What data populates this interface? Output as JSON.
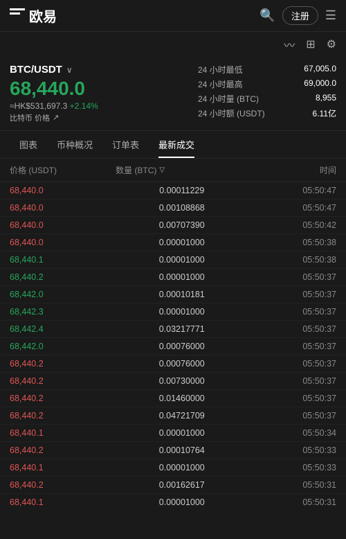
{
  "header": {
    "logo_text": "欧易",
    "register_label": "注册",
    "search_icon": "🔍",
    "menu_icon": "☰"
  },
  "header2": {
    "chart_icon": "📈",
    "grid_icon": "⊞",
    "settings_icon": "⚙"
  },
  "market": {
    "pair": "BTC/USDT",
    "arrow": "∨",
    "price": "68,440.0",
    "hkd_price": "≈HK$531,697.3",
    "change": "+2.14%",
    "label": "比特币 价格",
    "external_icon": "↗",
    "stats": [
      {
        "label": "24 小时最低",
        "value": "67,005.0"
      },
      {
        "label": "24 小时最高",
        "value": "69,000.0"
      },
      {
        "label": "24 小时量 (BTC)",
        "value": "8,955"
      },
      {
        "label": "24 小时额 (USDT)",
        "value": "6.11亿"
      }
    ]
  },
  "tabs": [
    {
      "id": "chart",
      "label": "图表"
    },
    {
      "id": "overview",
      "label": "币种概况"
    },
    {
      "id": "orders",
      "label": "订单表"
    },
    {
      "id": "trades",
      "label": "最新成交",
      "active": true
    }
  ],
  "table": {
    "col_price": "价格 (USDT)",
    "col_qty": "数量 (BTC)",
    "col_time": "时间",
    "rows": [
      {
        "price": "68,440.0",
        "color": "red",
        "qty": "0.00011229",
        "time": "05:50:47"
      },
      {
        "price": "68,440.0",
        "color": "red",
        "qty": "0.00108868",
        "time": "05:50:47"
      },
      {
        "price": "68,440.0",
        "color": "red",
        "qty": "0.00707390",
        "time": "05:50:42"
      },
      {
        "price": "68,440.0",
        "color": "red",
        "qty": "0.00001000",
        "time": "05:50:38"
      },
      {
        "price": "68,440.1",
        "color": "green",
        "qty": "0.00001000",
        "time": "05:50:38"
      },
      {
        "price": "68,440.2",
        "color": "green",
        "qty": "0.00001000",
        "time": "05:50:37"
      },
      {
        "price": "68,442.0",
        "color": "green",
        "qty": "0.00010181",
        "time": "05:50:37"
      },
      {
        "price": "68,442.3",
        "color": "green",
        "qty": "0.00001000",
        "time": "05:50:37"
      },
      {
        "price": "68,442.4",
        "color": "green",
        "qty": "0.03217771",
        "time": "05:50:37"
      },
      {
        "price": "68,442.0",
        "color": "green",
        "qty": "0.00076000",
        "time": "05:50:37"
      },
      {
        "price": "68,440.2",
        "color": "red",
        "qty": "0.00076000",
        "time": "05:50:37"
      },
      {
        "price": "68,440.2",
        "color": "red",
        "qty": "0.00730000",
        "time": "05:50:37"
      },
      {
        "price": "68,440.2",
        "color": "red",
        "qty": "0.01460000",
        "time": "05:50:37"
      },
      {
        "price": "68,440.2",
        "color": "red",
        "qty": "0.04721709",
        "time": "05:50:37"
      },
      {
        "price": "68,440.1",
        "color": "red",
        "qty": "0.00001000",
        "time": "05:50:34"
      },
      {
        "price": "68,440.2",
        "color": "red",
        "qty": "0.00010764",
        "time": "05:50:33"
      },
      {
        "price": "68,440.1",
        "color": "red",
        "qty": "0.00001000",
        "time": "05:50:33"
      },
      {
        "price": "68,440.2",
        "color": "red",
        "qty": "0.00162617",
        "time": "05:50:31"
      },
      {
        "price": "68,440.1",
        "color": "red",
        "qty": "0.00001000",
        "time": "05:50:31"
      }
    ]
  }
}
